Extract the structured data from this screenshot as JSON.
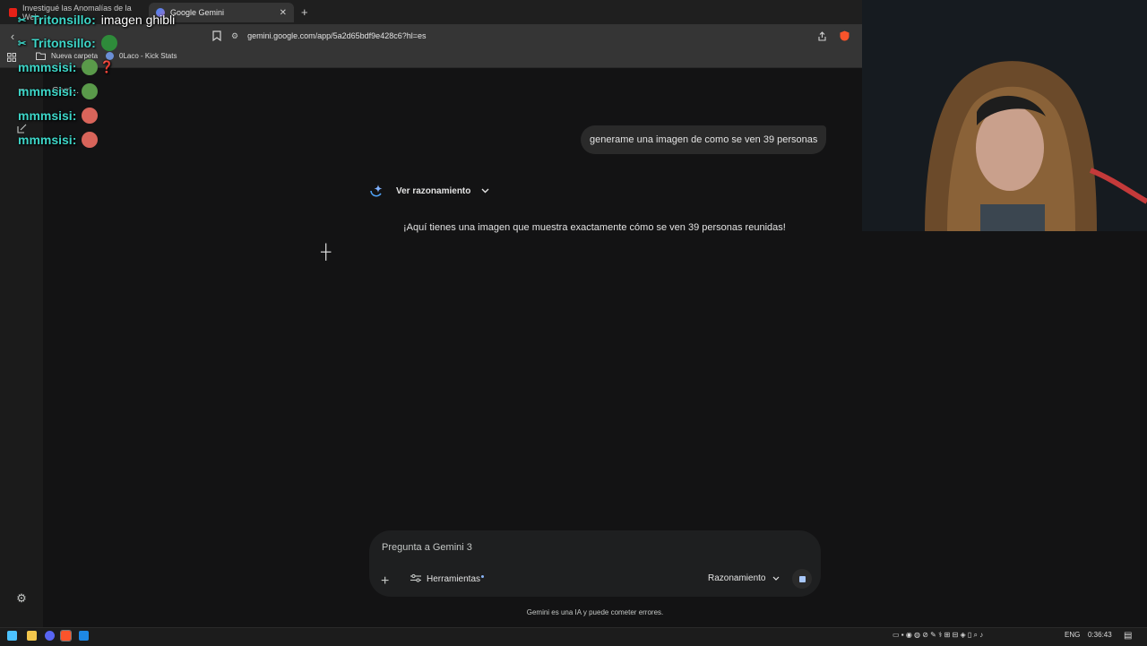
{
  "browser": {
    "tabs": [
      {
        "label": "Investigué las Anomalías de la Web",
        "active": false
      },
      {
        "label": "Google Gemini",
        "active": true
      }
    ],
    "url": "gemini.google.com/app/5a2d65bdf9e428c6?hl=es",
    "bookmarks": [
      {
        "label": "Nueva carpeta",
        "icon": "folder-icon"
      },
      {
        "label": "0Laco - Kick Stats",
        "icon": "link-icon"
      }
    ]
  },
  "sidebar": {
    "label_partial": "Gem..."
  },
  "conversation": {
    "user_message": "generame una imagen de como se ven 39 personas",
    "reasoning_toggle": "Ver razonamiento",
    "response": "¡Aquí tienes una imagen que muestra exactamente cómo se ven 39 personas reunidas!"
  },
  "input": {
    "placeholder": "Pregunta a Gemini 3",
    "tools_label": "Herramientas",
    "mode_label": "Razonamiento"
  },
  "footer": {
    "disclaimer": "Gemini es una IA y puede cometer errores."
  },
  "stream_chat": [
    {
      "user": "Tritonsillo:",
      "text": "imagen ghibli"
    },
    {
      "user": "Tritonsillo:",
      "text": ""
    },
    {
      "user": "mmmsisi:",
      "text": ""
    },
    {
      "user": "mmmsisi:",
      "text": ""
    },
    {
      "user": "mmmsisi:",
      "text": ""
    },
    {
      "user": "mmmsisi:",
      "text": ""
    }
  ],
  "taskbar": {
    "language": "ENG",
    "time": "0:36:43"
  },
  "colors": {
    "background": "#131314",
    "chat_name": "#3dd6c8",
    "accent": "#a8c7fa"
  }
}
